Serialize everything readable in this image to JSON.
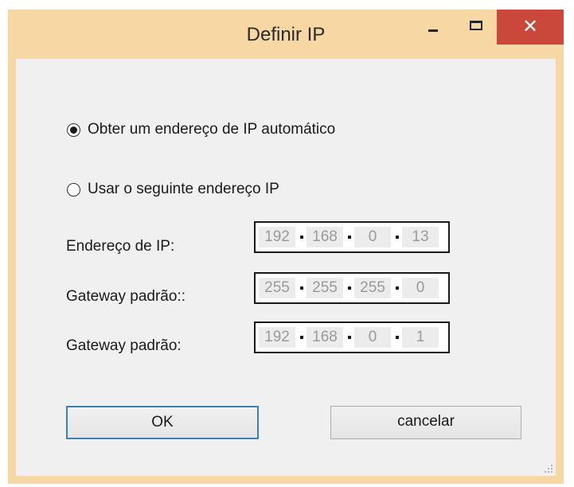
{
  "window": {
    "title": "Definir IP",
    "close_glyph": "✕"
  },
  "options": {
    "auto_label": "Obter um endereço de IP automático",
    "auto_selected": true,
    "manual_label": "Usar o seguinte endereço IP",
    "manual_selected": false
  },
  "fields": [
    {
      "label": "Endereço de IP:",
      "octets": [
        "192",
        "168",
        "0",
        "13"
      ]
    },
    {
      "label": "Gateway padrão::",
      "octets": [
        "255",
        "255",
        "255",
        "0"
      ]
    },
    {
      "label": "Gateway padrão:",
      "octets": [
        "192",
        "168",
        "0",
        "1"
      ]
    }
  ],
  "buttons": {
    "ok_label": "OK",
    "cancel_label": "cancelar"
  },
  "colors": {
    "frame": "#f7d7a4",
    "close_button": "#c9473b",
    "client_background": "#f0f0f0",
    "default_button_border": "#3c7fb1"
  },
  "icons": {
    "minimize": "minimize-icon",
    "maximize": "maximize-icon",
    "close": "close-icon",
    "resize_grip": "resize-grip-icon"
  }
}
